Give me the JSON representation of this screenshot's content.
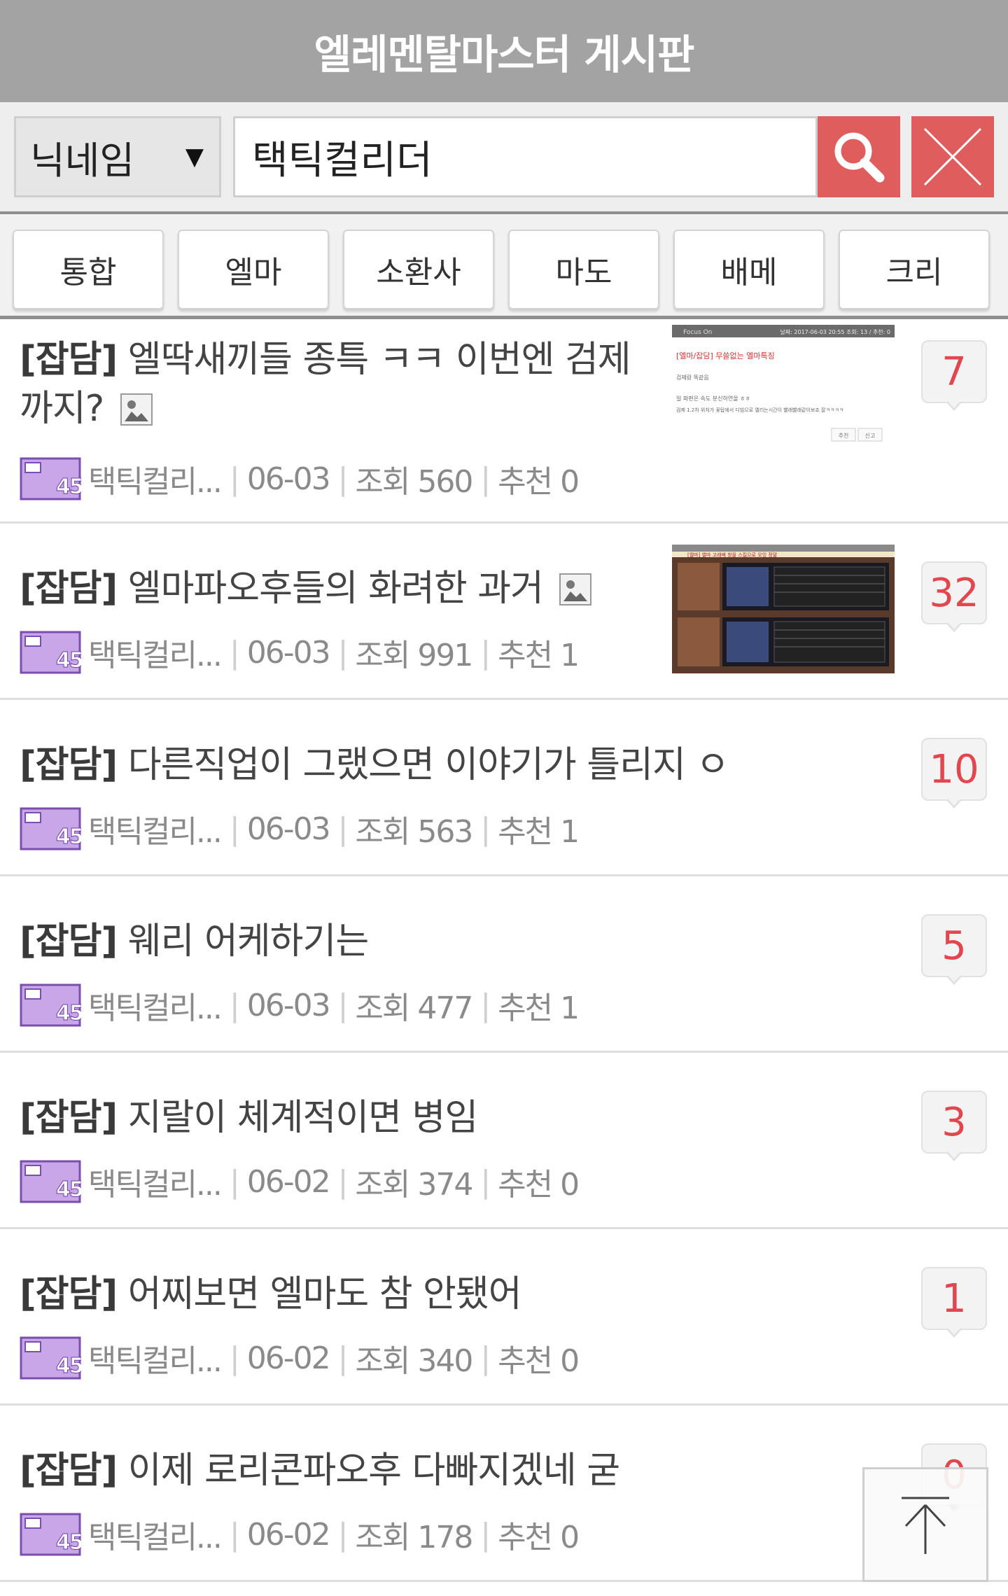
{
  "header": {
    "title": "엘레멘탈마스터 게시판"
  },
  "search": {
    "filter_label": "닉네임",
    "filter_arrow": "▼",
    "query_value": "택틱컬리더"
  },
  "tabs": [
    {
      "label": "통합"
    },
    {
      "label": "엘마"
    },
    {
      "label": "소환사"
    },
    {
      "label": "마도"
    },
    {
      "label": "배메"
    },
    {
      "label": "크리"
    }
  ],
  "posts": [
    {
      "category": "[잡담]",
      "title": "엘딱새끼들 종특 ㅋㅋ 이번엔 검제 까지?",
      "has_image": true,
      "author": "택틱컬리...",
      "date": "06-03",
      "views": "조회 560",
      "recommend": "추천 0",
      "comments": "7"
    },
    {
      "category": "[잡담]",
      "title": "엘마파오후들의 화려한 과거",
      "has_image": true,
      "author": "택틱컬리...",
      "date": "06-03",
      "views": "조회 991",
      "recommend": "추천 1",
      "comments": "32"
    },
    {
      "category": "[잡담]",
      "title": "다른직업이 그랬으면 이야기가 틀리지 ㅇ",
      "has_image": false,
      "author": "택틱컬리...",
      "date": "06-03",
      "views": "조회 563",
      "recommend": "추천 1",
      "comments": "10"
    },
    {
      "category": "[잡담]",
      "title": "웨리 어케하기는",
      "has_image": false,
      "author": "택틱컬리...",
      "date": "06-03",
      "views": "조회 477",
      "recommend": "추천 1",
      "comments": "5"
    },
    {
      "category": "[잡담]",
      "title": "지랄이 체계적이면 병임",
      "has_image": false,
      "author": "택틱컬리...",
      "date": "06-02",
      "views": "조회 374",
      "recommend": "추천 0",
      "comments": "3"
    },
    {
      "category": "[잡담]",
      "title": "어찌보면 엘마도 참 안됐어",
      "has_image": false,
      "author": "택틱컬리...",
      "date": "06-02",
      "views": "조회 340",
      "recommend": "추천 0",
      "comments": "1"
    },
    {
      "category": "[잡담]",
      "title": "이제 로리콘파오후 다빠지겠네 굳",
      "has_image": false,
      "author": "택틱컬리...",
      "date": "06-02",
      "views": "조회 178",
      "recommend": "추천 0",
      "comments": "0"
    }
  ],
  "level_badge": {
    "text": "45"
  },
  "thumb1": {
    "header_left": "Focus On",
    "header_right": "날짜: 2017-06-03 20:55   조회: 13 / 추천: 0",
    "title": "[엘마/잡담] 무쓸없는 엘마특징",
    "line1": "검제랑 똑같음",
    "line2": "일 파편은 속도 분신하연을 ㅎㅎ",
    "line3": "검제 1.2차 위처가 꽃탑에서 디빔으로 엘리는시간이 빨래빨래같이보죠 잘ㅋㅋㅋㅋ",
    "btn1": "추천",
    "btn2": "신고"
  },
  "thumb2": {
    "banner": "[엘마] 엘마 고래배 창을 스킬으로 오잉 정말"
  },
  "colors": {
    "header_bg": "#a3a3a3",
    "accent_red": "#e05d5d",
    "comment_red": "#e0474f"
  }
}
